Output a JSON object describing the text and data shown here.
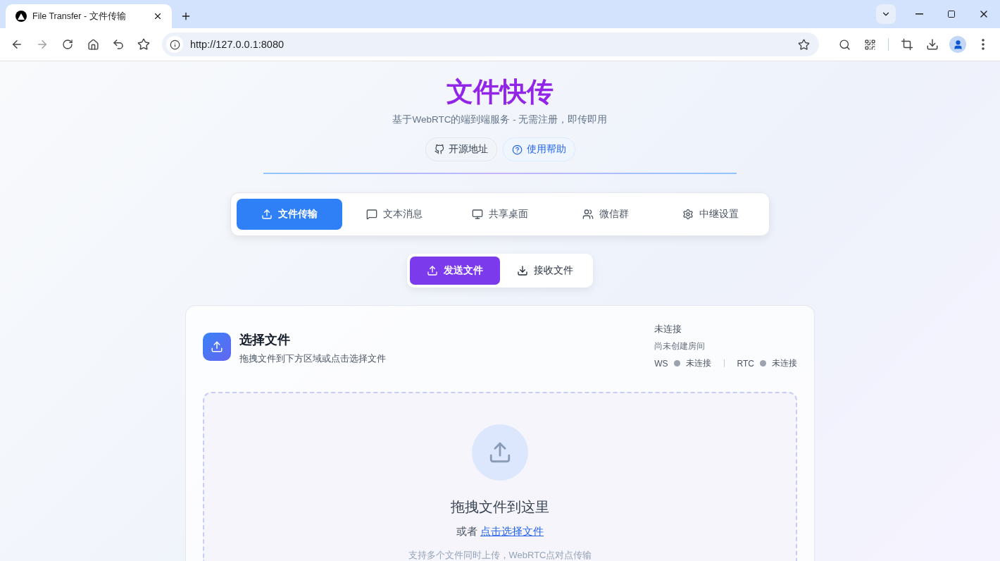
{
  "browser": {
    "tab_title": "File Transfer - 文件传输",
    "url": "http://127.0.0.1:8080"
  },
  "header": {
    "title": "文件快传",
    "subtitle": "基于WebRTC的端到端服务 - 无需注册，即传即用",
    "links": [
      {
        "label": "开源地址",
        "kind": "github"
      },
      {
        "label": "使用帮助",
        "kind": "help"
      }
    ]
  },
  "nav_tabs": [
    {
      "label": "文件传输",
      "kind": "upload",
      "selected": true
    },
    {
      "label": "文本消息",
      "kind": "message",
      "selected": false
    },
    {
      "label": "共享桌面",
      "kind": "monitor",
      "selected": false
    },
    {
      "label": "微信群",
      "kind": "users",
      "selected": false
    },
    {
      "label": "中继设置",
      "kind": "settings",
      "selected": false
    }
  ],
  "mode_tabs": [
    {
      "label": "发送文件",
      "kind": "upload",
      "selected": true
    },
    {
      "label": "接收文件",
      "kind": "download",
      "selected": false
    }
  ],
  "card": {
    "title": "选择文件",
    "subtitle": "拖拽文件到下方区域或点击选择文件",
    "status": {
      "state": "未连接",
      "room": "尚未创建房间",
      "channels": [
        {
          "name": "WS",
          "state": "未连接",
          "color": "#9ca3af"
        },
        {
          "name": "RTC",
          "state": "未连接",
          "color": "#9ca3af"
        }
      ]
    },
    "dropzone": {
      "heading": "拖拽文件到这里",
      "prefix": "或者",
      "link": "点击选择文件",
      "hint": "支持多个文件同时上传，WebRTC点对点传输"
    }
  }
}
